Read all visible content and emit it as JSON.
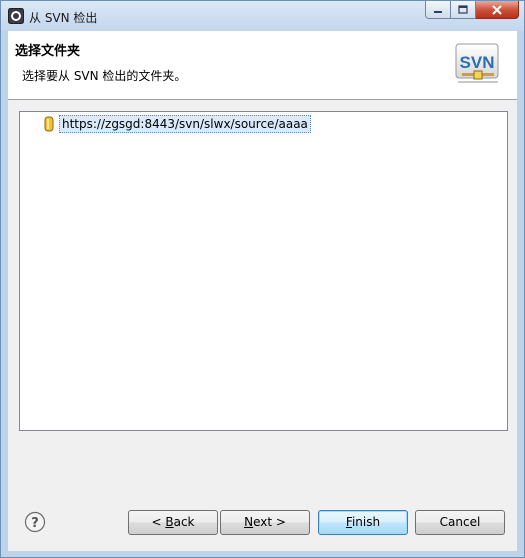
{
  "window": {
    "title": "从 SVN 检出"
  },
  "header": {
    "title": "选择文件夹",
    "description": "选择要从 SVN 检出的文件夹。"
  },
  "tree": {
    "items": [
      {
        "label": "https://zgsgd:8443/svn/slwx/source/aaaa",
        "icon": "repository-icon",
        "selected": true
      }
    ]
  },
  "footer": {
    "help_icon": "question-mark-icon",
    "back": {
      "prefix": "< ",
      "mnemonic": "B",
      "rest": "ack"
    },
    "next": {
      "mnemonic": "N",
      "rest": "ext",
      "suffix": " >"
    },
    "finish": {
      "mnemonic": "F",
      "rest": "inish"
    },
    "cancel": {
      "label": "Cancel"
    }
  },
  "colors": {
    "titlebar": "#c3d6ec",
    "close_button": "#c94f3a",
    "default_button_border": "#3c7fb1",
    "selection": "#dbeafb"
  }
}
